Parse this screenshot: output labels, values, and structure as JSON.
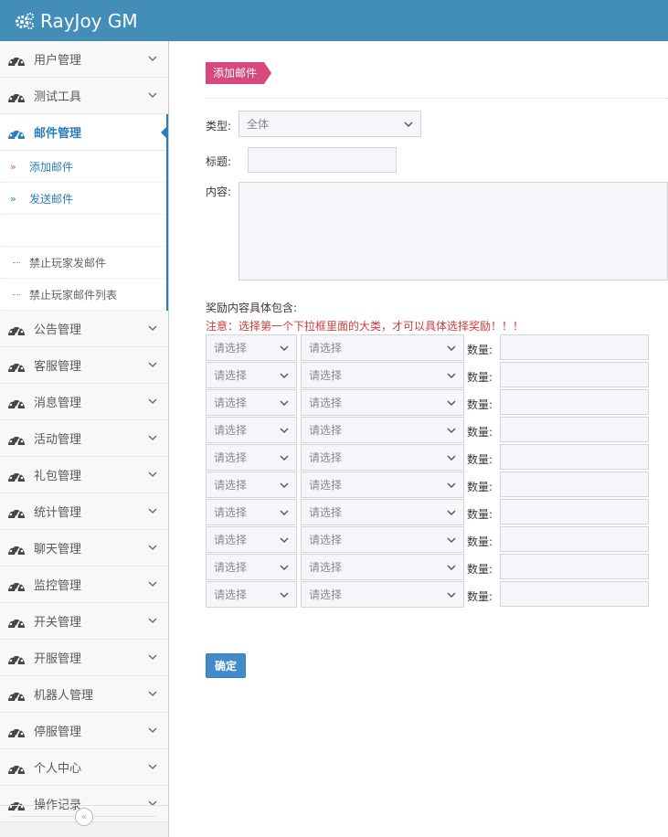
{
  "header": {
    "brand": "RayJoy GM",
    "brand_icon": "cogs-icon",
    "bg_color": "#438eb9"
  },
  "sidebar": {
    "items_top": [
      {
        "label": "用户管理"
      },
      {
        "label": "测试工具"
      },
      {
        "label": "邮件管理",
        "active": true
      }
    ],
    "submenu": [
      {
        "label": "添加邮件",
        "current": true
      },
      {
        "label": "发送邮件"
      },
      {
        "label": ""
      },
      {
        "label": "禁止玩家发邮件"
      },
      {
        "label": "禁止玩家邮件列表"
      }
    ],
    "items_bottom": [
      {
        "label": "公告管理"
      },
      {
        "label": "客服管理"
      },
      {
        "label": "消息管理"
      },
      {
        "label": "活动管理"
      },
      {
        "label": "礼包管理"
      },
      {
        "label": "统计管理"
      },
      {
        "label": "聊天管理"
      },
      {
        "label": "监控管理"
      },
      {
        "label": "开关管理"
      },
      {
        "label": "开服管理"
      },
      {
        "label": "机器人管理"
      },
      {
        "label": "停服管理"
      },
      {
        "label": "个人中心"
      },
      {
        "label": "操作记录"
      }
    ],
    "collapse_glyph": "«"
  },
  "main": {
    "page_tag": "添加邮件",
    "form": {
      "type_label": "类型:",
      "type_value": "全体",
      "title_label": "标题:",
      "title_value": "",
      "content_label": "内容:",
      "content_value": "",
      "reward_heading": "奖励内容具体包含:",
      "reward_note": "注意：选择第一个下拉框里面的大类，才可以具体选择奖励！！！",
      "reward_rows": [
        {
          "category": "请选择",
          "item": "请选择",
          "qty_label": "数量:",
          "qty": ""
        },
        {
          "category": "请选择",
          "item": "请选择",
          "qty_label": "数量:",
          "qty": ""
        },
        {
          "category": "请选择",
          "item": "请选择",
          "qty_label": "数量:",
          "qty": ""
        },
        {
          "category": "请选择",
          "item": "请选择",
          "qty_label": "数量:",
          "qty": ""
        },
        {
          "category": "请选择",
          "item": "请选择",
          "qty_label": "数量:",
          "qty": ""
        },
        {
          "category": "请选择",
          "item": "请选择",
          "qty_label": "数量:",
          "qty": ""
        },
        {
          "category": "请选择",
          "item": "请选择",
          "qty_label": "数量:",
          "qty": ""
        },
        {
          "category": "请选择",
          "item": "请选择",
          "qty_label": "数量:",
          "qty": ""
        },
        {
          "category": "请选择",
          "item": "请选择",
          "qty_label": "数量:",
          "qty": ""
        },
        {
          "category": "请选择",
          "item": "请选择",
          "qty_label": "数量:",
          "qty": ""
        }
      ],
      "confirm_label": "确定"
    }
  },
  "colors": {
    "accent": "#2b7dbc",
    "tag": "#d6487e",
    "note": "#d03b3b",
    "button": "#428bca"
  }
}
